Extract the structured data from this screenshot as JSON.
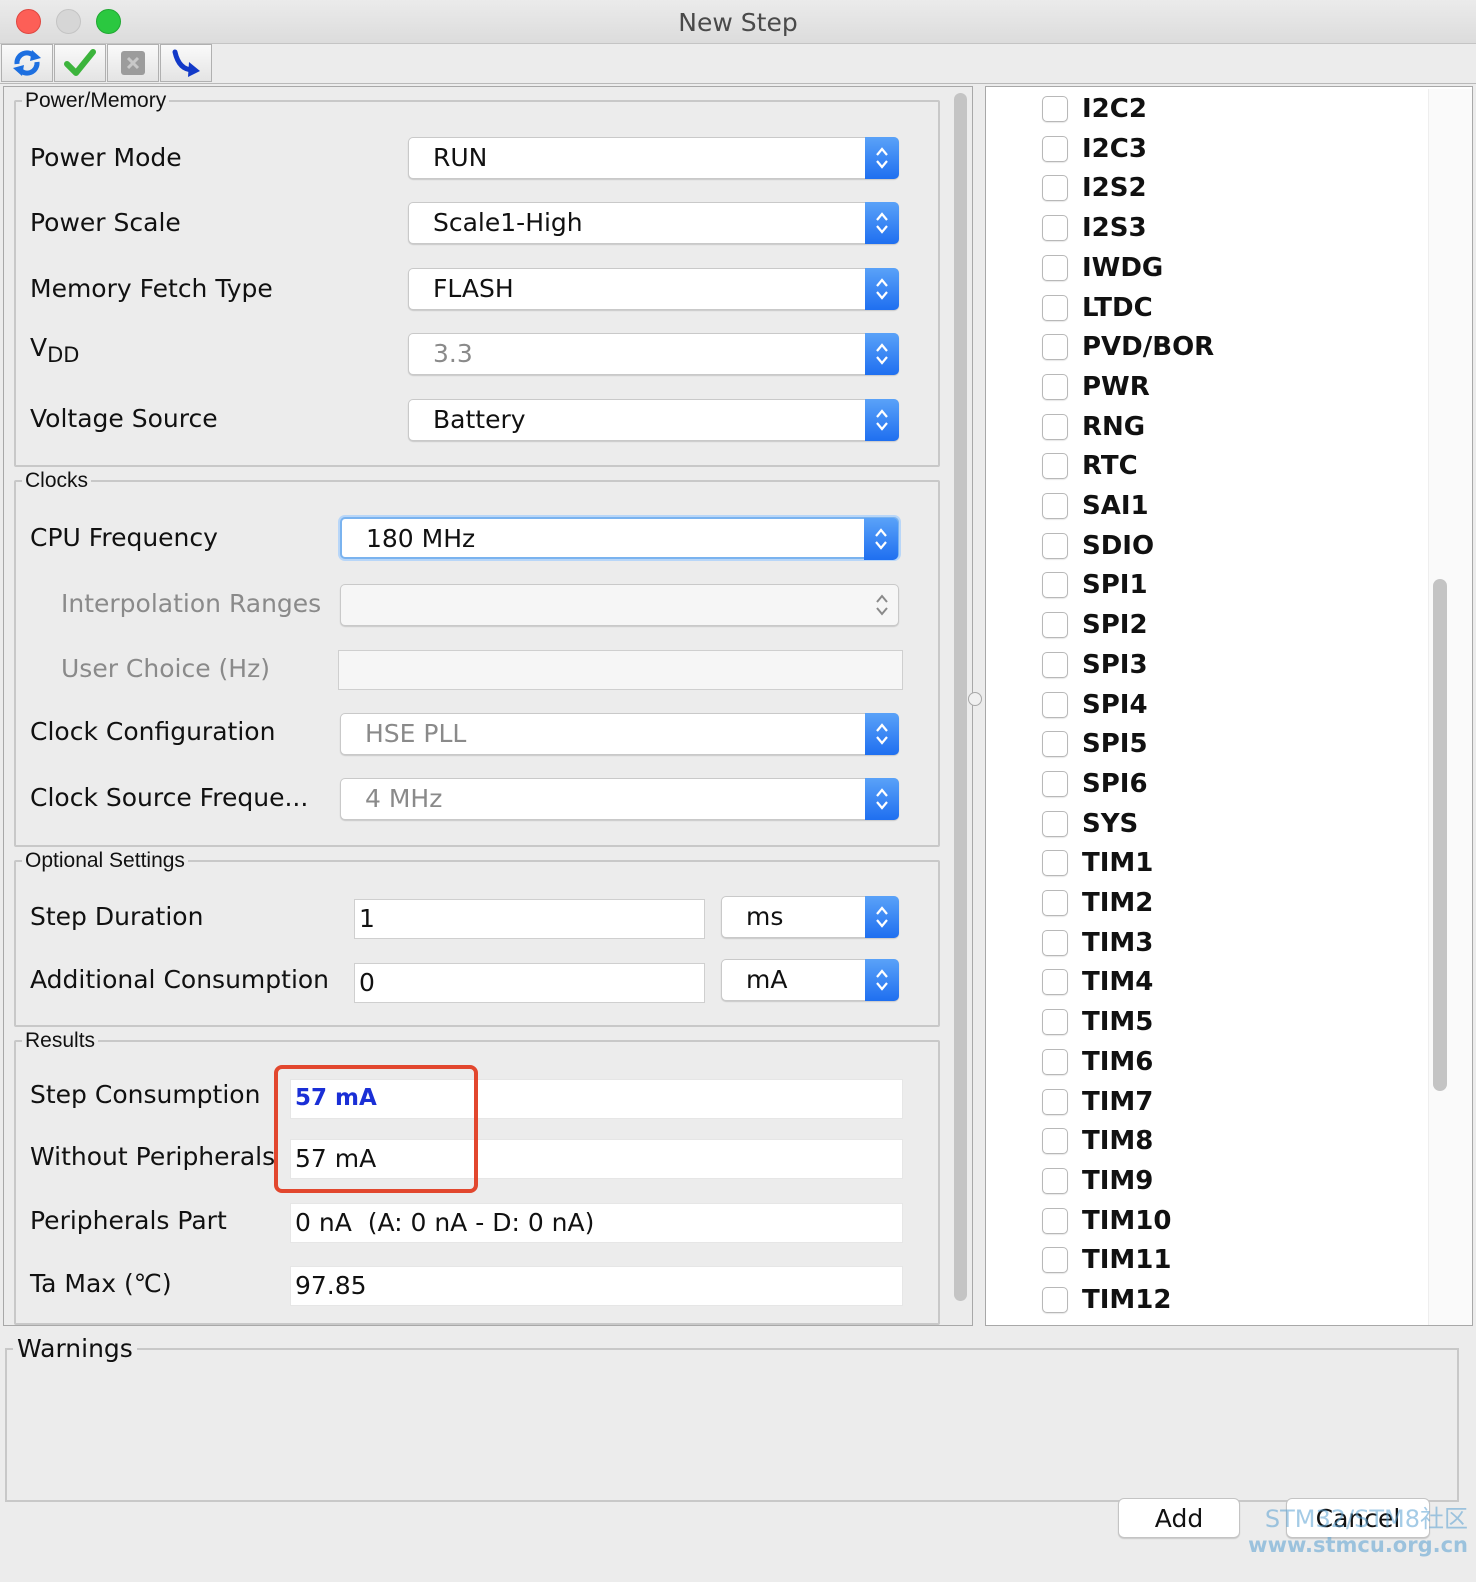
{
  "window": {
    "title": "New Step"
  },
  "toolbar": {
    "icons": [
      "refresh-icon",
      "check-icon",
      "delete-icon",
      "jump-icon"
    ]
  },
  "power_memory": {
    "legend": "Power/Memory",
    "power_mode": {
      "label": "Power Mode",
      "value": "RUN"
    },
    "power_scale": {
      "label": "Power Scale",
      "value": "Scale1-High"
    },
    "memory_fetch": {
      "label": "Memory Fetch Type",
      "value": "FLASH"
    },
    "vdd": {
      "label_main": "V",
      "label_sub": "DD",
      "value": "3.3"
    },
    "voltage_source": {
      "label": "Voltage Source",
      "value": "Battery"
    }
  },
  "clocks": {
    "legend": "Clocks",
    "cpu_frequency": {
      "label": "CPU Frequency",
      "value": "180 MHz"
    },
    "interpolation": {
      "label": "Interpolation Ranges",
      "value": ""
    },
    "user_choice": {
      "label": "User Choice (Hz)",
      "value": ""
    },
    "clock_config": {
      "label": "Clock Configuration",
      "value": "HSE PLL"
    },
    "clock_source": {
      "label": "Clock Source Freque...",
      "value": "4 MHz"
    }
  },
  "optional": {
    "legend": "Optional Settings",
    "step_duration": {
      "label": "Step Duration",
      "value": "1",
      "unit": "ms"
    },
    "additional": {
      "label": "Additional Consumption",
      "value": "0",
      "unit": "mA"
    }
  },
  "results": {
    "legend": "Results",
    "step_consumption": {
      "label": "Step Consumption",
      "value": "57 mA"
    },
    "without_peripherals": {
      "label": "Without Peripherals",
      "value": "57 mA"
    },
    "peripherals_part": {
      "label": "Peripherals Part",
      "value": "0 nA  (A: 0 nA - D: 0 nA)"
    },
    "ta_max": {
      "label": "Ta Max (℃)",
      "value": "97.85"
    }
  },
  "peripherals": [
    "I2C2",
    "I2C3",
    "I2S2",
    "I2S3",
    "IWDG",
    "LTDC",
    "PVD/BOR",
    "PWR",
    "RNG",
    "RTC",
    "SAI1",
    "SDIO",
    "SPI1",
    "SPI2",
    "SPI3",
    "SPI4",
    "SPI5",
    "SPI6",
    "SYS",
    "TIM1",
    "TIM2",
    "TIM3",
    "TIM4",
    "TIM5",
    "TIM6",
    "TIM7",
    "TIM8",
    "TIM9",
    "TIM10",
    "TIM11",
    "TIM12"
  ],
  "warnings": {
    "legend": "Warnings"
  },
  "buttons": {
    "add": "Add",
    "cancel": "Cancel"
  },
  "watermark": {
    "line1": "STM32/STM8社区",
    "line2": "www.stmcu.org.cn"
  },
  "colors": {
    "accent": "#1f6ff0",
    "highlight": "#e2472e",
    "step_value": "#1a2fd6"
  }
}
